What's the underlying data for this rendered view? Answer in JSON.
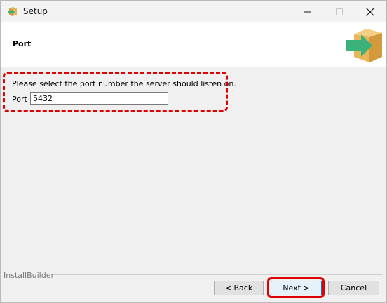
{
  "window": {
    "title": "Setup"
  },
  "header": {
    "title": "Port"
  },
  "content": {
    "instruction": "Please select the port number the server should listen on.",
    "port_label": "Port",
    "port_value": "5432"
  },
  "footer": {
    "brand": "InstallBuilder",
    "back_label": "< Back",
    "next_label": "Next >",
    "cancel_label": "Cancel"
  },
  "icons": {
    "app": "setup-box-icon",
    "header": "installer-box-arrow-icon",
    "minimize": "minimize-icon",
    "maximize": "maximize-icon",
    "close": "close-icon"
  },
  "colors": {
    "highlight": "#e00000",
    "arrow_green": "#3bb27a",
    "box_orange": "#e9b65a"
  }
}
